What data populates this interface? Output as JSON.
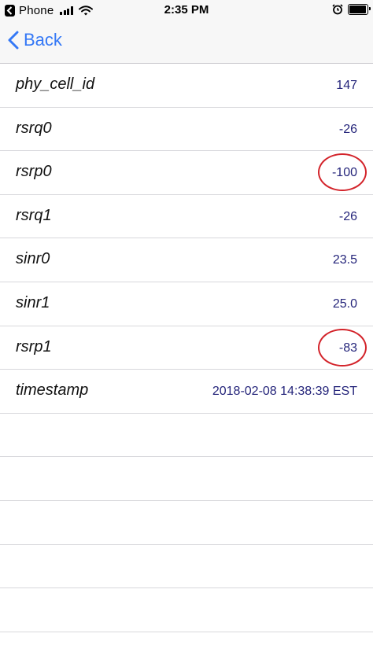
{
  "status_bar": {
    "back_app_label": "Phone",
    "time": "2:35 PM"
  },
  "nav": {
    "back_label": "Back"
  },
  "rows": [
    {
      "label": "phy_cell_id",
      "value": "147",
      "highlighted": false
    },
    {
      "label": "rsrq0",
      "value": "-26",
      "highlighted": false
    },
    {
      "label": "rsrp0",
      "value": "-100",
      "highlighted": true
    },
    {
      "label": "rsrq1",
      "value": "-26",
      "highlighted": false
    },
    {
      "label": "sinr0",
      "value": "23.5",
      "highlighted": false
    },
    {
      "label": "sinr1",
      "value": "25.0",
      "highlighted": false
    },
    {
      "label": "rsrp1",
      "value": "-83",
      "highlighted": true
    },
    {
      "label": "timestamp",
      "value": "2018-02-08 14:38:39 EST",
      "highlighted": false
    }
  ],
  "empty_row_count": 5,
  "colors": {
    "accent": "#3478f6",
    "value_text": "#24247a",
    "highlight": "#d3232a"
  }
}
